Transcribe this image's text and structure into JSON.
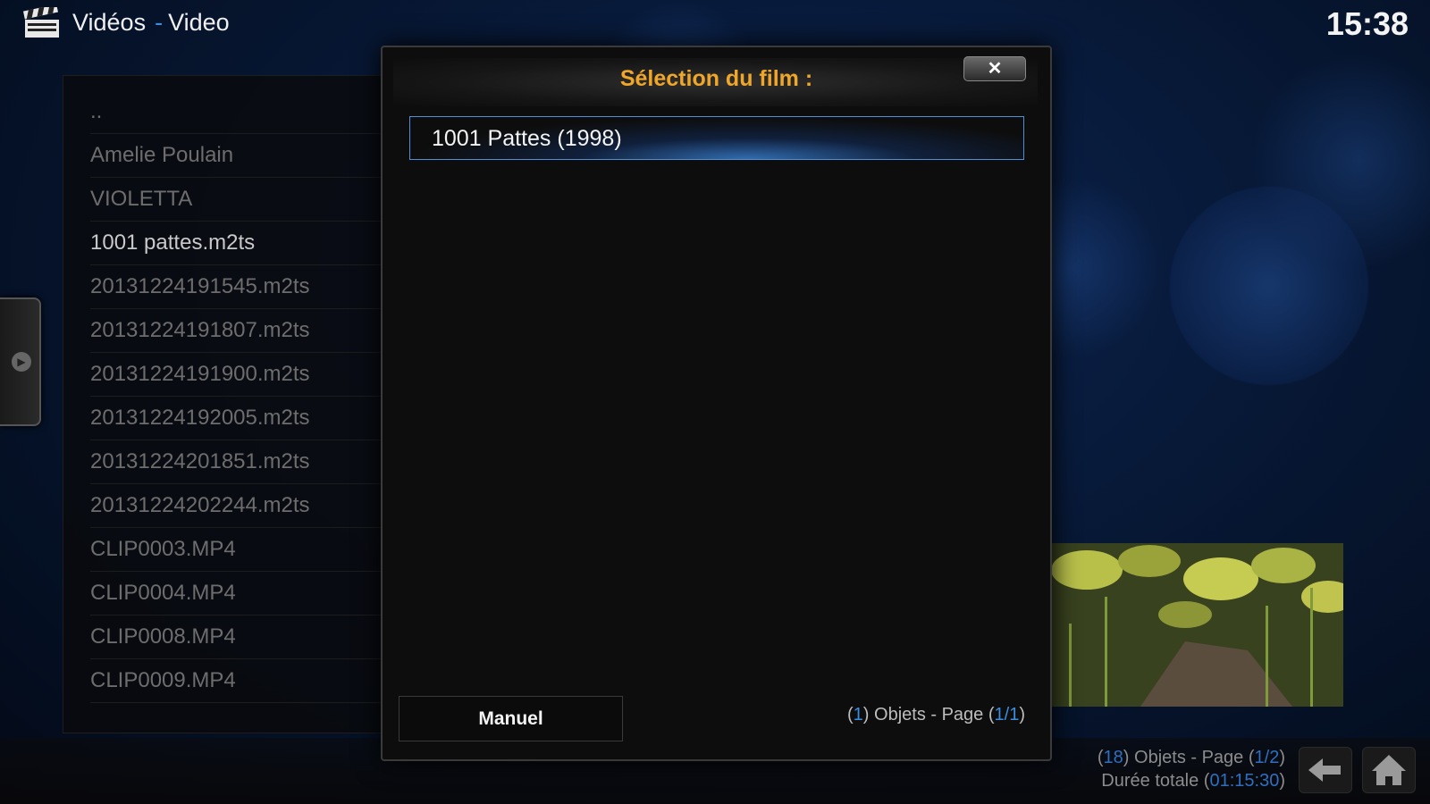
{
  "header": {
    "section": "Vidéos",
    "separator": "-",
    "subsection": "Video",
    "clock": "15:38",
    "icon": "clapperboard-icon"
  },
  "file_list": {
    "items": [
      {
        "label": ".."
      },
      {
        "label": "Amelie Poulain"
      },
      {
        "label": "VIOLETTA"
      },
      {
        "label": "1001 pattes.m2ts"
      },
      {
        "label": "20131224191545.m2ts"
      },
      {
        "label": "20131224191807.m2ts"
      },
      {
        "label": "20131224191900.m2ts"
      },
      {
        "label": "20131224192005.m2ts"
      },
      {
        "label": "20131224201851.m2ts"
      },
      {
        "label": "20131224202244.m2ts"
      },
      {
        "label": "CLIP0003.MP4"
      },
      {
        "label": "CLIP0004.MP4"
      },
      {
        "label": "CLIP0008.MP4"
      },
      {
        "label": "CLIP0009.MP4"
      }
    ]
  },
  "footer": {
    "count_open": "(",
    "count": "18",
    "count_text": ") Objets - Page (",
    "page": "1/2",
    "page_close": ")",
    "duration_label": "Durée totale (",
    "duration": "01:15:30",
    "duration_close": ")"
  },
  "dialog": {
    "title": "Sélection du film :",
    "close_label": "✕",
    "results": [
      {
        "label": "1001 Pattes (1998)"
      }
    ],
    "manual_label": "Manuel",
    "info_open": "(",
    "info_count": "1",
    "info_text": ") Objets - Page (",
    "info_page": "1/1",
    "info_close": ")"
  },
  "colors": {
    "accent": "#3b8de0",
    "title": "#f0a628"
  }
}
